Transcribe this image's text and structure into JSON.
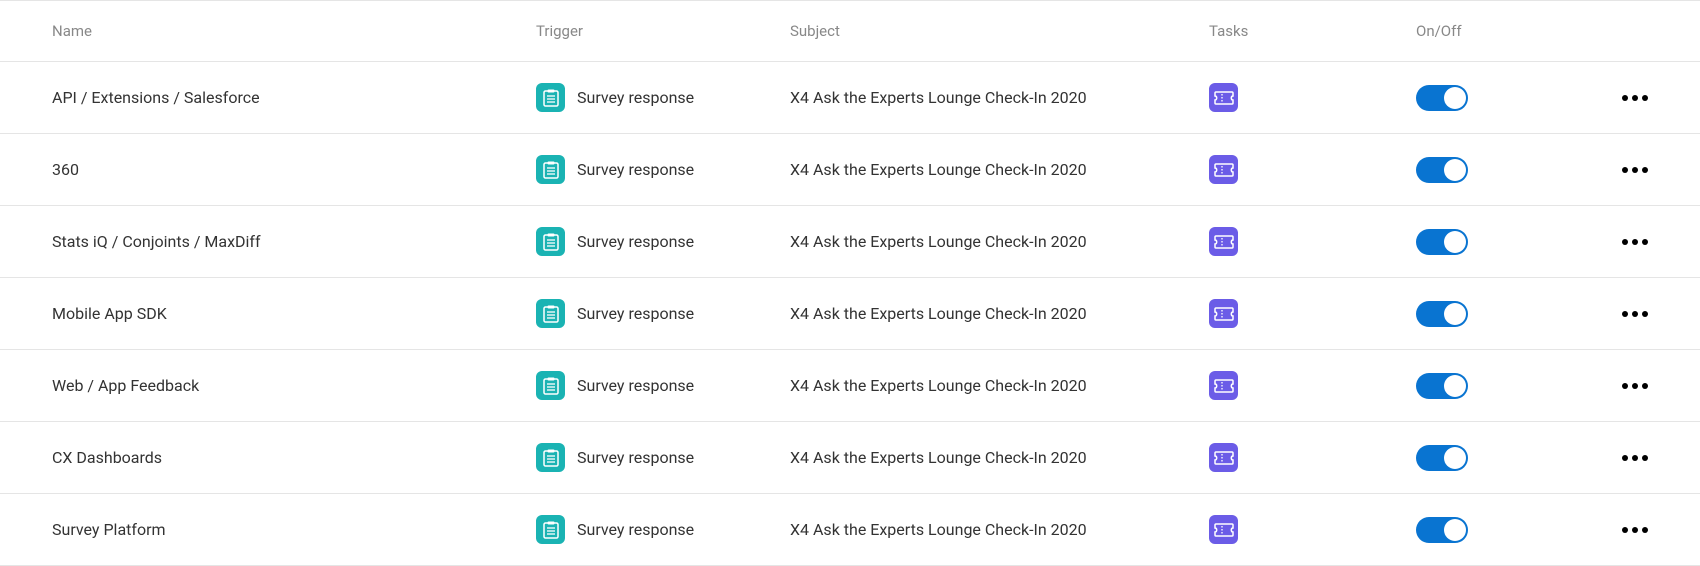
{
  "columns": {
    "name": "Name",
    "trigger": "Trigger",
    "subject": "Subject",
    "tasks": "Tasks",
    "onoff": "On/Off"
  },
  "rows": [
    {
      "name": "API / Extensions / Salesforce",
      "trigger": "Survey response",
      "subject": "X4 Ask the Experts Lounge Check-In 2020",
      "on": true
    },
    {
      "name": "360",
      "trigger": "Survey response",
      "subject": "X4 Ask the Experts Lounge Check-In 2020",
      "on": true
    },
    {
      "name": "Stats iQ / Conjoints / MaxDiff",
      "trigger": "Survey response",
      "subject": "X4 Ask the Experts Lounge Check-In 2020",
      "on": true
    },
    {
      "name": "Mobile App SDK",
      "trigger": "Survey response",
      "subject": "X4 Ask the Experts Lounge Check-In 2020",
      "on": true
    },
    {
      "name": "Web / App Feedback",
      "trigger": "Survey response",
      "subject": "X4 Ask the Experts Lounge Check-In 2020",
      "on": true
    },
    {
      "name": "CX Dashboards",
      "trigger": "Survey response",
      "subject": "X4 Ask the Experts Lounge Check-In 2020",
      "on": true
    },
    {
      "name": "Survey Platform",
      "trigger": "Survey response",
      "subject": "X4 Ask the Experts Lounge Check-In 2020",
      "on": true
    }
  ],
  "icons": {
    "trigger": "clipboard-icon",
    "task": "ticket-icon"
  }
}
